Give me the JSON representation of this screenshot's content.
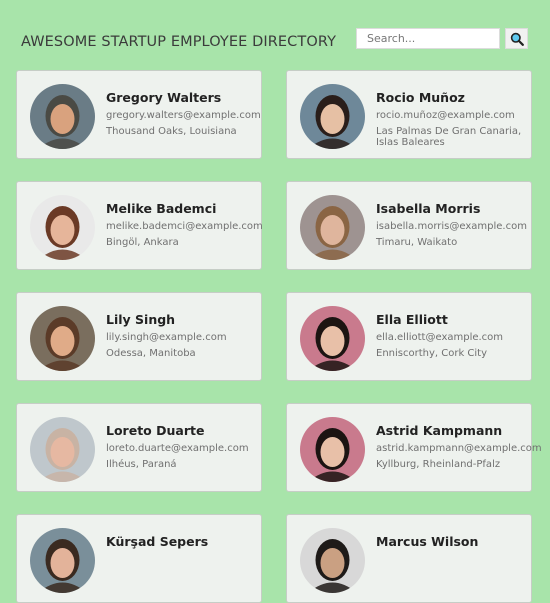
{
  "header": {
    "title": "AWESOME STARTUP EMPLOYEE DIRECTORY",
    "search_placeholder": "Search...",
    "search_icon": "magnifier-icon"
  },
  "employees": [
    {
      "name": "Gregory Walters",
      "email": "gregory.walters@example.com",
      "location": "Thousand Oaks, Louisiana",
      "avatar": {
        "bg": "#6a7c86",
        "skin": "#d9a27e",
        "hair": "#4a4a44"
      }
    },
    {
      "name": "Rocio Muñoz",
      "email": "rocio.muñoz@example.com",
      "location": "Las Palmas De Gran Canaria, Islas Baleares",
      "avatar": {
        "bg": "#6e8899",
        "skin": "#e6c0a4",
        "hair": "#2a1e1a"
      }
    },
    {
      "name": "Melike Bademci",
      "email": "melike.bademci@example.com",
      "location": "Bingöl, Ankara",
      "avatar": {
        "bg": "#e9e9e9",
        "skin": "#e6b59a",
        "hair": "#6b3a26"
      }
    },
    {
      "name": "Isabella Morris",
      "email": "isabella.morris@example.com",
      "location": "Timaru, Waikato",
      "avatar": {
        "bg": "#9e9391",
        "skin": "#dfb59d",
        "hair": "#8a6544"
      }
    },
    {
      "name": "Lily Singh",
      "email": "lily.singh@example.com",
      "location": "Odessa, Manitoba",
      "avatar": {
        "bg": "#7a6e5e",
        "skin": "#e0ab88",
        "hair": "#5b3b28"
      }
    },
    {
      "name": "Ella Elliott",
      "email": "ella.elliott@example.com",
      "location": "Enniscorthy, Cork City",
      "avatar": {
        "bg": "#c97a8d",
        "skin": "#e8c0a8",
        "hair": "#1c1412"
      }
    },
    {
      "name": "Loreto Duarte",
      "email": "loreto.duarte@example.com",
      "location": "Ilhéus, Paraná",
      "avatar": {
        "bg": "#bfc7cc",
        "skin": "#e6b8a2",
        "hair": "#c8b3a4"
      }
    },
    {
      "name": "Astrid Kampmann",
      "email": "astrid.kampmann@example.com",
      "location": "Kyllburg, Rheinland-Pfalz",
      "avatar": {
        "bg": "#c97a8d",
        "skin": "#e8c0a8",
        "hair": "#1c1412"
      }
    },
    {
      "name": "Kürşad Sepers",
      "email": "",
      "location": "",
      "avatar": {
        "bg": "#7a8f9a",
        "skin": "#e3b39a",
        "hair": "#3a2a20"
      }
    },
    {
      "name": "Marcus Wilson",
      "email": "",
      "location": "",
      "avatar": {
        "bg": "#d8d8d8",
        "skin": "#caa082",
        "hair": "#1e1a18"
      }
    }
  ]
}
